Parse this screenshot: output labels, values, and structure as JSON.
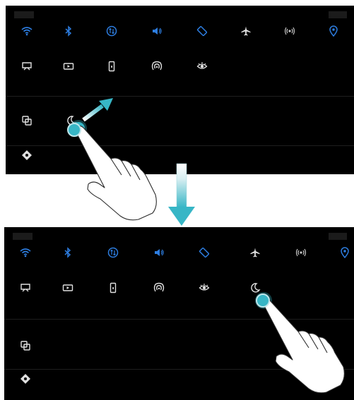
{
  "colors": {
    "active": "#2d7de0",
    "inactive": "#e0e0e0",
    "touch": "#37b6c6",
    "arrow": "#37b6c6",
    "panel": "#000000"
  },
  "top": {
    "status_left": "",
    "status_right": "",
    "row1": [
      {
        "icon": "wifi-icon",
        "label": "",
        "active": true
      },
      {
        "icon": "bluetooth-icon",
        "label": "",
        "active": true
      },
      {
        "icon": "mobile-data-icon",
        "label": "",
        "active": true
      },
      {
        "icon": "sound-icon",
        "label": "",
        "active": true
      },
      {
        "icon": "auto-rotate-icon",
        "label": "",
        "active": true
      },
      {
        "icon": "airplane-icon",
        "label": "",
        "active": false
      },
      {
        "icon": "hotspot-icon",
        "label": "",
        "active": false
      },
      {
        "icon": "location-icon",
        "label": "",
        "active": true
      }
    ],
    "row2": [
      {
        "icon": "screenshot-icon",
        "label": ""
      },
      {
        "icon": "screen-recorder-icon",
        "label": ""
      },
      {
        "icon": "flashlight-icon",
        "label": ""
      },
      {
        "icon": "nfc-icon",
        "label": ""
      },
      {
        "icon": "eye-comfort-icon",
        "label": ""
      }
    ],
    "drag_section_label": "",
    "drag_items": [
      {
        "icon": "multi-screen-icon",
        "label": ""
      },
      {
        "icon": "do-not-disturb-icon",
        "label": ""
      }
    ],
    "bottom_item": {
      "icon": "settings-diamond-icon",
      "label": ""
    }
  },
  "bottom": {
    "status_left": "",
    "status_right": "",
    "row1": [
      {
        "icon": "wifi-icon",
        "label": "",
        "active": true
      },
      {
        "icon": "bluetooth-icon",
        "label": "",
        "active": true
      },
      {
        "icon": "mobile-data-icon",
        "label": "",
        "active": true
      },
      {
        "icon": "sound-icon",
        "label": "",
        "active": true
      },
      {
        "icon": "auto-rotate-icon",
        "label": "",
        "active": true
      },
      {
        "icon": "airplane-icon",
        "label": "",
        "active": false
      },
      {
        "icon": "hotspot-icon",
        "label": "",
        "active": false
      },
      {
        "icon": "location-icon",
        "label": "",
        "active": true
      }
    ],
    "row2": [
      {
        "icon": "screenshot-icon",
        "label": ""
      },
      {
        "icon": "screen-recorder-icon",
        "label": ""
      },
      {
        "icon": "flashlight-icon",
        "label": ""
      },
      {
        "icon": "nfc-icon",
        "label": ""
      },
      {
        "icon": "eye-comfort-icon",
        "label": ""
      },
      {
        "icon": "do-not-disturb-icon",
        "label": ""
      }
    ],
    "drag_section_label": "",
    "drag_items": [
      {
        "icon": "multi-screen-icon",
        "label": ""
      }
    ],
    "bottom_item": {
      "icon": "settings-diamond-icon",
      "label": ""
    }
  }
}
